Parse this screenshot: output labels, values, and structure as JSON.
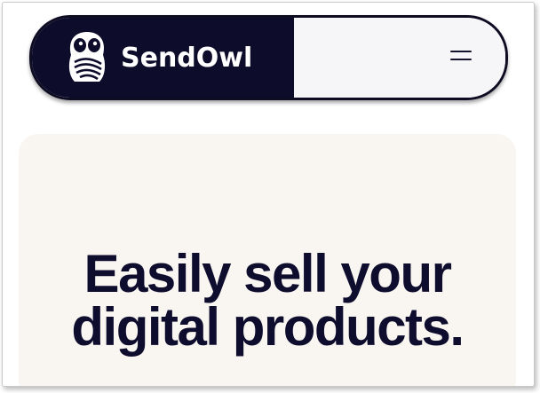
{
  "brand": {
    "name": "SendOwl",
    "logo_icon": "owl-logo-icon"
  },
  "nav": {
    "menu_icon": "hamburger-menu-icon"
  },
  "hero": {
    "title_line1": "Easily sell your",
    "title_line2": "digital products."
  },
  "colors": {
    "brand_dark": "#0e0c2b",
    "nav_light": "#f6f6f8",
    "hero_bg": "#f9f6f1",
    "text_dark": "#0f0d2e"
  }
}
